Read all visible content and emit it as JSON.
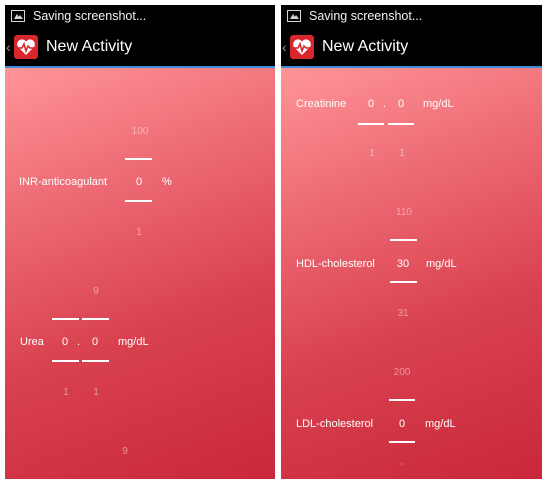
{
  "status_text": "Saving screenshot...",
  "title": "New Activity",
  "left": {
    "inr": {
      "label": "INR-anticoagulant",
      "above": "100",
      "value": "0",
      "unit": "%",
      "below": "1"
    },
    "urea": {
      "label": "Urea",
      "above": "9",
      "int_value": "0",
      "dot": ".",
      "dec_value": "0",
      "unit": "mg/dL",
      "below_int": "1",
      "below_dec": "1"
    },
    "bottom_partial": "9"
  },
  "right": {
    "creatinine": {
      "label": "Creatinine",
      "int_value": "0",
      "dot": ".",
      "dec_value": "0",
      "unit": "mg/dL",
      "below_int": "1",
      "below_dec": "1"
    },
    "hdl": {
      "label": "HDL-cholesterol",
      "above": "110",
      "value": "30",
      "unit": "mg/dL",
      "below": "31"
    },
    "ldl": {
      "label": "LDL-cholesterol",
      "above": "200",
      "value": "0",
      "unit": "mg/dL",
      "below": "'"
    }
  }
}
